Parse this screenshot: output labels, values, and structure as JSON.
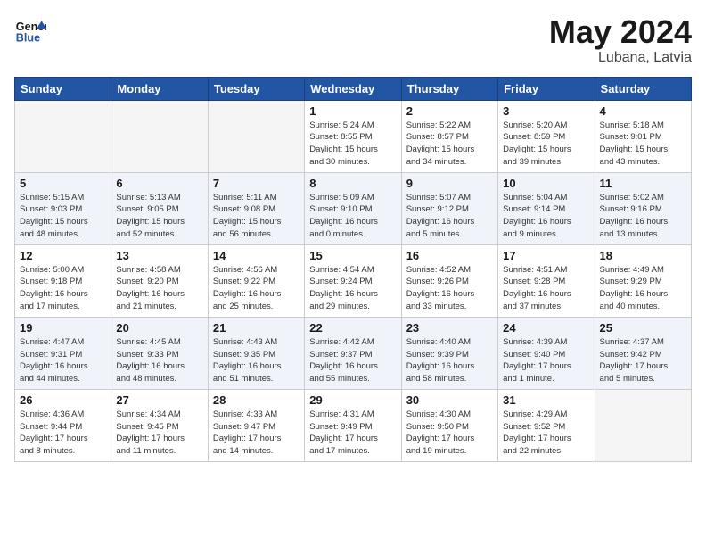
{
  "header": {
    "logo_line1": "General",
    "logo_line2": "Blue",
    "month_year": "May 2024",
    "location": "Lubana, Latvia"
  },
  "days_of_week": [
    "Sunday",
    "Monday",
    "Tuesday",
    "Wednesday",
    "Thursday",
    "Friday",
    "Saturday"
  ],
  "weeks": [
    {
      "alt": false,
      "days": [
        {
          "num": "",
          "info": ""
        },
        {
          "num": "",
          "info": ""
        },
        {
          "num": "",
          "info": ""
        },
        {
          "num": "1",
          "info": "Sunrise: 5:24 AM\nSunset: 8:55 PM\nDaylight: 15 hours\nand 30 minutes."
        },
        {
          "num": "2",
          "info": "Sunrise: 5:22 AM\nSunset: 8:57 PM\nDaylight: 15 hours\nand 34 minutes."
        },
        {
          "num": "3",
          "info": "Sunrise: 5:20 AM\nSunset: 8:59 PM\nDaylight: 15 hours\nand 39 minutes."
        },
        {
          "num": "4",
          "info": "Sunrise: 5:18 AM\nSunset: 9:01 PM\nDaylight: 15 hours\nand 43 minutes."
        }
      ]
    },
    {
      "alt": true,
      "days": [
        {
          "num": "5",
          "info": "Sunrise: 5:15 AM\nSunset: 9:03 PM\nDaylight: 15 hours\nand 48 minutes."
        },
        {
          "num": "6",
          "info": "Sunrise: 5:13 AM\nSunset: 9:05 PM\nDaylight: 15 hours\nand 52 minutes."
        },
        {
          "num": "7",
          "info": "Sunrise: 5:11 AM\nSunset: 9:08 PM\nDaylight: 15 hours\nand 56 minutes."
        },
        {
          "num": "8",
          "info": "Sunrise: 5:09 AM\nSunset: 9:10 PM\nDaylight: 16 hours\nand 0 minutes."
        },
        {
          "num": "9",
          "info": "Sunrise: 5:07 AM\nSunset: 9:12 PM\nDaylight: 16 hours\nand 5 minutes."
        },
        {
          "num": "10",
          "info": "Sunrise: 5:04 AM\nSunset: 9:14 PM\nDaylight: 16 hours\nand 9 minutes."
        },
        {
          "num": "11",
          "info": "Sunrise: 5:02 AM\nSunset: 9:16 PM\nDaylight: 16 hours\nand 13 minutes."
        }
      ]
    },
    {
      "alt": false,
      "days": [
        {
          "num": "12",
          "info": "Sunrise: 5:00 AM\nSunset: 9:18 PM\nDaylight: 16 hours\nand 17 minutes."
        },
        {
          "num": "13",
          "info": "Sunrise: 4:58 AM\nSunset: 9:20 PM\nDaylight: 16 hours\nand 21 minutes."
        },
        {
          "num": "14",
          "info": "Sunrise: 4:56 AM\nSunset: 9:22 PM\nDaylight: 16 hours\nand 25 minutes."
        },
        {
          "num": "15",
          "info": "Sunrise: 4:54 AM\nSunset: 9:24 PM\nDaylight: 16 hours\nand 29 minutes."
        },
        {
          "num": "16",
          "info": "Sunrise: 4:52 AM\nSunset: 9:26 PM\nDaylight: 16 hours\nand 33 minutes."
        },
        {
          "num": "17",
          "info": "Sunrise: 4:51 AM\nSunset: 9:28 PM\nDaylight: 16 hours\nand 37 minutes."
        },
        {
          "num": "18",
          "info": "Sunrise: 4:49 AM\nSunset: 9:29 PM\nDaylight: 16 hours\nand 40 minutes."
        }
      ]
    },
    {
      "alt": true,
      "days": [
        {
          "num": "19",
          "info": "Sunrise: 4:47 AM\nSunset: 9:31 PM\nDaylight: 16 hours\nand 44 minutes."
        },
        {
          "num": "20",
          "info": "Sunrise: 4:45 AM\nSunset: 9:33 PM\nDaylight: 16 hours\nand 48 minutes."
        },
        {
          "num": "21",
          "info": "Sunrise: 4:43 AM\nSunset: 9:35 PM\nDaylight: 16 hours\nand 51 minutes."
        },
        {
          "num": "22",
          "info": "Sunrise: 4:42 AM\nSunset: 9:37 PM\nDaylight: 16 hours\nand 55 minutes."
        },
        {
          "num": "23",
          "info": "Sunrise: 4:40 AM\nSunset: 9:39 PM\nDaylight: 16 hours\nand 58 minutes."
        },
        {
          "num": "24",
          "info": "Sunrise: 4:39 AM\nSunset: 9:40 PM\nDaylight: 17 hours\nand 1 minute."
        },
        {
          "num": "25",
          "info": "Sunrise: 4:37 AM\nSunset: 9:42 PM\nDaylight: 17 hours\nand 5 minutes."
        }
      ]
    },
    {
      "alt": false,
      "days": [
        {
          "num": "26",
          "info": "Sunrise: 4:36 AM\nSunset: 9:44 PM\nDaylight: 17 hours\nand 8 minutes."
        },
        {
          "num": "27",
          "info": "Sunrise: 4:34 AM\nSunset: 9:45 PM\nDaylight: 17 hours\nand 11 minutes."
        },
        {
          "num": "28",
          "info": "Sunrise: 4:33 AM\nSunset: 9:47 PM\nDaylight: 17 hours\nand 14 minutes."
        },
        {
          "num": "29",
          "info": "Sunrise: 4:31 AM\nSunset: 9:49 PM\nDaylight: 17 hours\nand 17 minutes."
        },
        {
          "num": "30",
          "info": "Sunrise: 4:30 AM\nSunset: 9:50 PM\nDaylight: 17 hours\nand 19 minutes."
        },
        {
          "num": "31",
          "info": "Sunrise: 4:29 AM\nSunset: 9:52 PM\nDaylight: 17 hours\nand 22 minutes."
        },
        {
          "num": "",
          "info": ""
        }
      ]
    }
  ]
}
